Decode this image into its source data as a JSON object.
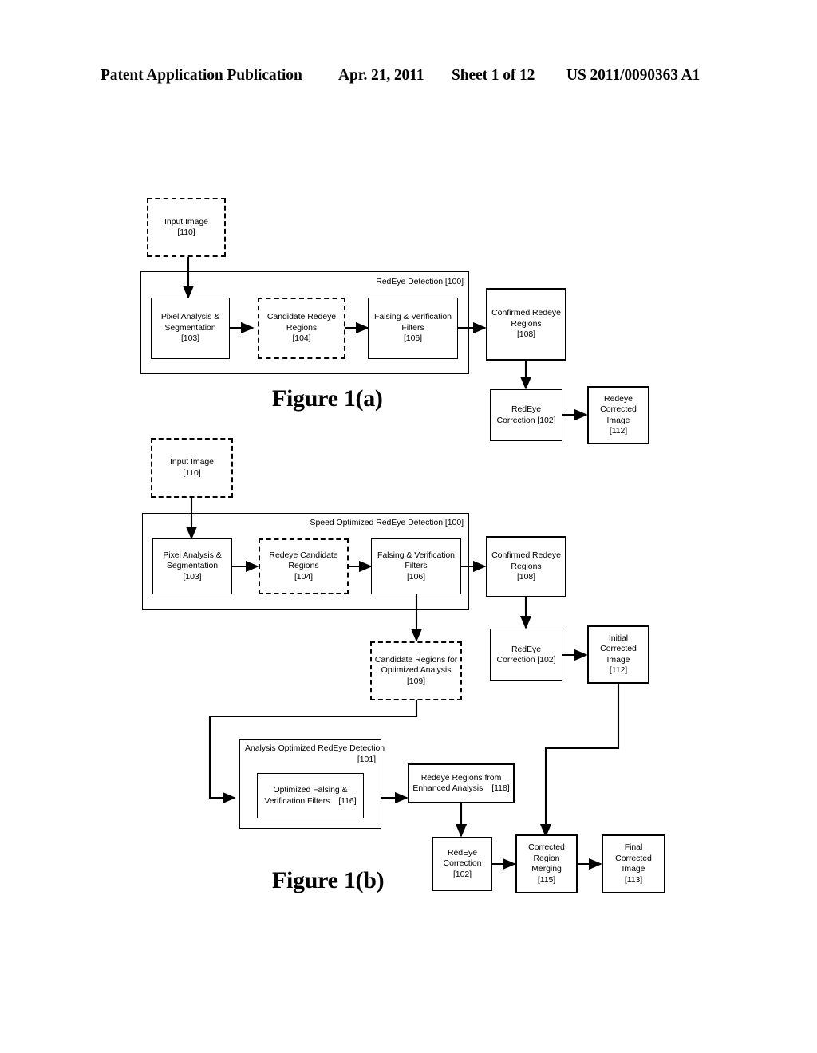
{
  "header": {
    "publication": "Patent Application Publication",
    "date": "Apr. 21, 2011",
    "sheet": "Sheet 1 of 12",
    "pub_number": "US 2011/0090363 A1"
  },
  "figures": [
    {
      "caption": "Figure 1(a)",
      "container_label": "RedEye Detection [100]",
      "nodes": {
        "input_image": {
          "line1": "Input Image",
          "line2": "[110]"
        },
        "pixel_analysis": {
          "line1": "Pixel Analysis &",
          "line2": "Segmentation",
          "line3": "[103]"
        },
        "candidate_regions": {
          "line1": "Candidate Redeye",
          "line2": "Regions",
          "line3": "[104]"
        },
        "falsing_filters": {
          "line1": "Falsing & Verification",
          "line2": "Filters",
          "line3": "[106]"
        },
        "confirmed_regions": {
          "line1": "Confirmed Redeye",
          "line2": "Regions",
          "line3": "[108]"
        },
        "redeye_correction": {
          "line1": "RedEye",
          "line2": "Correction [102]"
        },
        "corrected_image": {
          "line1": "Redeye",
          "line2": "Corrected",
          "line3": "Image",
          "line4": "[112]"
        }
      }
    },
    {
      "caption": "Figure 1(b)",
      "container_label": "Speed Optimized RedEye Detection [100]",
      "nodes": {
        "input_image": {
          "line1": "Input Image",
          "line2": "[110]"
        },
        "pixel_analysis": {
          "line1": "Pixel Analysis &",
          "line2": "Segmentation",
          "line3": "[103]"
        },
        "candidate_regions": {
          "line1": "Redeye Candidate",
          "line2": "Regions",
          "line3": "[104]"
        },
        "falsing_filters": {
          "line1": "Falsing & Verification",
          "line2": "Filters",
          "line3": "[106]"
        },
        "confirmed_regions": {
          "line1": "Confirmed Redeye",
          "line2": "Regions",
          "line3": "[108]"
        },
        "redeye_correction_1": {
          "line1": "RedEye",
          "line2": "Correction [102]"
        },
        "initial_corrected_image": {
          "line1": "Initial",
          "line2": "Corrected",
          "line3": "Image",
          "line4": "[112]"
        },
        "candidate_optimized": {
          "line1": "Candidate Regions for",
          "line2": "Optimized Analysis",
          "line3": "[109]"
        },
        "analysis_optimized_label": {
          "line1": "Analysis Optimized RedEye Detection",
          "line2": "[101]"
        },
        "optimized_filters": {
          "line1": "Optimized Falsing &",
          "line2": "Verification Filters",
          "ref": "[116]"
        },
        "enhanced_regions": {
          "line1": "Redeye Regions from",
          "line2": "Enhanced Analysis",
          "ref": "[118]"
        },
        "redeye_correction_2": {
          "line1": "RedEye",
          "line2": "Correction",
          "line3": "[102]"
        },
        "region_merging": {
          "line1": "Corrected",
          "line2": "Region",
          "line3": "Merging",
          "line4": "[115]"
        },
        "final_image": {
          "line1": "Final",
          "line2": "Corrected",
          "line3": "Image",
          "line4": "[113]"
        }
      }
    }
  ],
  "colors": {
    "ink": "#000000",
    "paper": "#ffffff"
  }
}
